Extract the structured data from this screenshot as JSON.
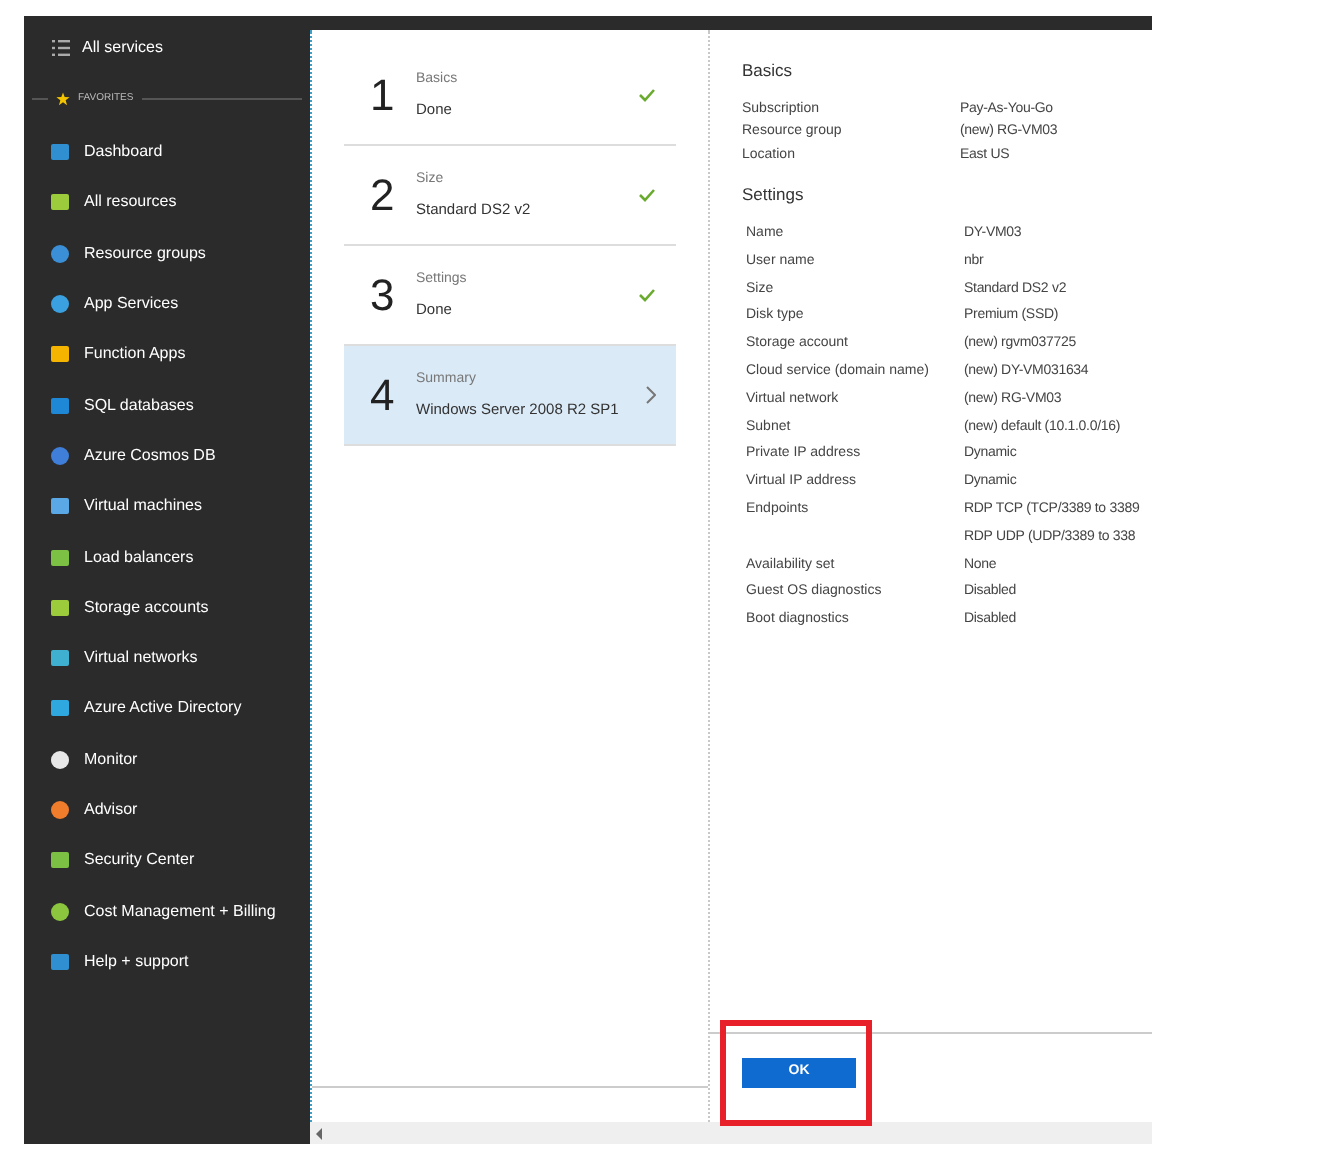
{
  "sidebar": {
    "all_services": "All services",
    "favorites_label": "FAVORITES",
    "items": [
      {
        "label": "Dashboard"
      },
      {
        "label": "All resources"
      },
      {
        "label": "Resource groups"
      },
      {
        "label": "App Services"
      },
      {
        "label": "Function Apps"
      },
      {
        "label": "SQL databases"
      },
      {
        "label": "Azure Cosmos DB"
      },
      {
        "label": "Virtual machines"
      },
      {
        "label": "Load balancers"
      },
      {
        "label": "Storage accounts"
      },
      {
        "label": "Virtual networks"
      },
      {
        "label": "Azure Active Directory"
      },
      {
        "label": "Monitor"
      },
      {
        "label": "Advisor"
      },
      {
        "label": "Security Center"
      },
      {
        "label": "Cost Management + Billing"
      },
      {
        "label": "Help + support"
      }
    ]
  },
  "steps": [
    {
      "number": "1",
      "title": "Basics",
      "subtitle": "Done",
      "done": true,
      "selected": false
    },
    {
      "number": "2",
      "title": "Size",
      "subtitle": "Standard DS2 v2",
      "done": true,
      "selected": false
    },
    {
      "number": "3",
      "title": "Settings",
      "subtitle": "Done",
      "done": true,
      "selected": false
    },
    {
      "number": "4",
      "title": "Summary",
      "subtitle": "Windows Server 2008 R2 SP1",
      "done": false,
      "selected": true
    }
  ],
  "summary": {
    "sections": [
      {
        "title": "Basics",
        "rows": [
          {
            "label": "Subscription",
            "values": [
              "Pay-As-You-Go"
            ]
          },
          {
            "label": "Resource group",
            "values": [
              "(new) RG-VM03"
            ]
          },
          {
            "label": "Location",
            "values": [
              "East US"
            ]
          }
        ]
      },
      {
        "title": "Settings",
        "rows": [
          {
            "label": "Name",
            "values": [
              "DY-VM03"
            ]
          },
          {
            "label": "User name",
            "values": [
              "nbr"
            ]
          },
          {
            "label": "Size",
            "values": [
              "Standard DS2 v2"
            ]
          },
          {
            "label": "Disk type",
            "values": [
              "Premium (SSD)"
            ]
          },
          {
            "label": "Storage account",
            "values": [
              "(new) rgvm037725"
            ]
          },
          {
            "label": "Cloud service (domain name)",
            "values": [
              "(new) DY-VM031634"
            ]
          },
          {
            "label": "Virtual network",
            "values": [
              "(new) RG-VM03"
            ]
          },
          {
            "label": "Subnet",
            "values": [
              "(new) default (10.1.0.0/16)"
            ]
          },
          {
            "label": "Private IP address",
            "values": [
              "Dynamic"
            ]
          },
          {
            "label": "Virtual IP address",
            "values": [
              "Dynamic"
            ]
          },
          {
            "label": "Endpoints",
            "values": [
              "RDP TCP (TCP/3389 to 3389",
              "RDP UDP (UDP/3389 to 338"
            ]
          },
          {
            "label": "Availability set",
            "values": [
              "None"
            ]
          },
          {
            "label": "Guest OS diagnostics",
            "values": [
              "Disabled"
            ]
          },
          {
            "label": "Boot diagnostics",
            "values": [
              "Disabled"
            ]
          }
        ]
      }
    ]
  },
  "ok_button": "OK"
}
